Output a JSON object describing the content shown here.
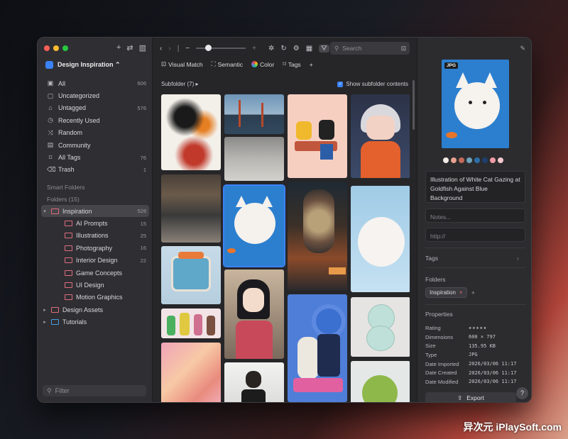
{
  "sidebar": {
    "library": "Design Inspiration ⌃",
    "nav": [
      {
        "label": "All",
        "count": "606",
        "icon": "▣"
      },
      {
        "label": "Uncategorized",
        "count": "",
        "icon": "▢"
      },
      {
        "label": "Untagged",
        "count": "576",
        "icon": "⌂"
      },
      {
        "label": "Recently Used",
        "count": "",
        "icon": "◷"
      },
      {
        "label": "Random",
        "count": "",
        "icon": "⤨"
      },
      {
        "label": "Community",
        "count": "",
        "icon": "▤"
      },
      {
        "label": "All Tags",
        "count": "76",
        "icon": "⌑"
      },
      {
        "label": "Trash",
        "count": "1",
        "icon": "⌫"
      }
    ],
    "smart_folders": "Smart Folders",
    "folders_heading": "Folders (15)",
    "folders": [
      {
        "label": "Inspiration",
        "count": "528",
        "level": 0,
        "caret": "▾",
        "color": "pink"
      },
      {
        "label": "AI Prompts",
        "count": "15",
        "level": 1,
        "caret": "",
        "color": "pink"
      },
      {
        "label": "Illustrations",
        "count": "25",
        "level": 1,
        "caret": "",
        "color": "pink"
      },
      {
        "label": "Photography",
        "count": "16",
        "level": 1,
        "caret": "",
        "color": "pink"
      },
      {
        "label": "Interior Design",
        "count": "22",
        "level": 1,
        "caret": "",
        "color": "pink"
      },
      {
        "label": "Game Concepts",
        "count": "",
        "level": 1,
        "caret": "",
        "color": "pink"
      },
      {
        "label": "UI Design",
        "count": "",
        "level": 1,
        "caret": "",
        "color": "pink"
      },
      {
        "label": "Motion Graphics",
        "count": "",
        "level": 1,
        "caret": "",
        "color": "pink"
      },
      {
        "label": "Design Assets",
        "count": "",
        "level": 0,
        "caret": "▸",
        "color": "pink"
      },
      {
        "label": "Tutorials",
        "count": "",
        "level": 0,
        "caret": "▸",
        "color": "blue"
      }
    ],
    "filter_placeholder": "Filter"
  },
  "toolbar": {
    "search_placeholder": "Search",
    "modes": [
      {
        "label": "Visual Match",
        "icon": "⊡"
      },
      {
        "label": "Semantic",
        "icon": "⛶"
      },
      {
        "label": "Color",
        "icon": "color-wheel"
      },
      {
        "label": "Tags",
        "icon": "⌑"
      },
      {
        "label": "",
        "icon": "+"
      }
    ],
    "subfolder": "Subfolder (7) ▸",
    "show_subfolder": "Show subfolder contents"
  },
  "inspector": {
    "badge": "JPG",
    "swatches": [
      "#f2ece6",
      "#e8a190",
      "#c26a5a",
      "#6ea3bb",
      "#2d6ea8",
      "#1e3f6e",
      "#ef9aa5",
      "#f4c8cf"
    ],
    "title": "Illustration of White Cat Gazing at Goldfish Against Blue Background",
    "notes_placeholder": "Notes...",
    "url_placeholder": "http://",
    "tags_label": "Tags",
    "folders_label": "Folders",
    "folder_pill": "Inspiration",
    "properties_label": "Properties",
    "props": [
      {
        "k": "Rating",
        "v": "★★★★★"
      },
      {
        "k": "Dimensions",
        "v": "600 × 797"
      },
      {
        "k": "Size",
        "v": "135.95 KB"
      },
      {
        "k": "Type",
        "v": "JPG"
      },
      {
        "k": "Date Imported",
        "v": "2026/03/06 11:17"
      },
      {
        "k": "Date Created",
        "v": "2026/03/06 11:17"
      },
      {
        "k": "Date Modified",
        "v": "2026/03/06 11:17"
      }
    ],
    "export": "Export",
    "help": "?"
  },
  "watermark": "异次元 iPlaySoft.com"
}
